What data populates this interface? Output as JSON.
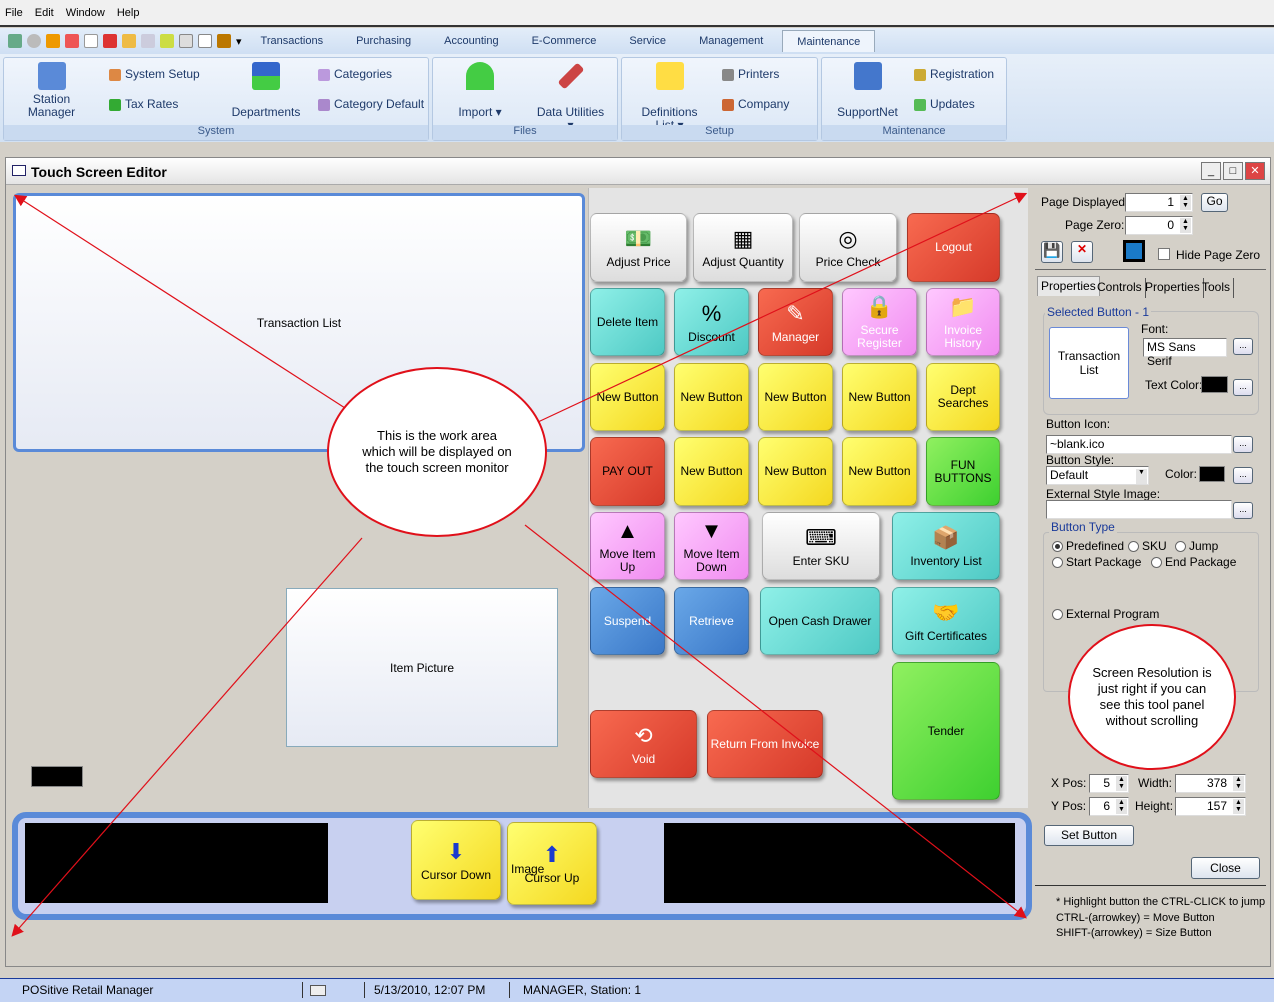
{
  "menu": [
    "File",
    "Edit",
    "Window",
    "Help"
  ],
  "ribbon_tabs": [
    "Transactions",
    "Purchasing",
    "Accounting",
    "E-Commerce",
    "Service",
    "Management",
    "Maintenance"
  ],
  "ribbon": {
    "station_manager": "Station Manager",
    "system_setup": "System Setup",
    "tax_rates": "Tax Rates",
    "departments": "Departments",
    "categories": "Categories",
    "category_default": "Category Default",
    "system": "System",
    "import": "Import",
    "data_utilities": "Data Utilities",
    "files": "Files",
    "definitions_list": "Definitions List",
    "printers": "Printers",
    "company": "Company",
    "setup": "Setup",
    "supportnet": "SupportNet",
    "registration": "Registration",
    "updates": "Updates",
    "maintenance": "Maintenance"
  },
  "window": {
    "title": "Touch Screen Editor",
    "minimize": "_",
    "maximize": "□",
    "close": "✕"
  },
  "editor": {
    "transaction_list": "Transaction List",
    "item_picture": "Item Picture",
    "buttons": {
      "adjust_price": "Adjust Price",
      "adjust_quantity": "Adjust Quantity",
      "price_check": "Price Check",
      "logout": "Logout",
      "delete_item": "Delete Item",
      "discount": "Discount",
      "manager": "Manager",
      "secure_register": "Secure Register",
      "invoice_history": "Invoice History",
      "new_button": "New Button",
      "dept_searches": "Dept Searches",
      "pay_out": "PAY OUT",
      "fun_buttons": "FUN BUTTONS",
      "move_item_up": "Move Item Up",
      "move_item_down": "Move Item Down",
      "enter_sku": "Enter SKU",
      "inventory_list": "Inventory List",
      "suspend": "Suspend",
      "retrieve": "Retrieve",
      "open_cash_drawer": "Open Cash Drawer",
      "gift_certificates": "Gift Certificates",
      "void": "Void",
      "return_from_invoice": "Return From Invoice",
      "tender": "Tender",
      "cursor_down": "Cursor Down",
      "cursor_up": "Cursor Up",
      "image": "Image"
    }
  },
  "annotations": {
    "work_area": "This is the work area which will be displayed on the touch screen monitor",
    "resolution": "Screen Resolution is just right if you can see this tool panel without scrolling",
    "color": "#e0101a"
  },
  "panel": {
    "page_displayed_label": "Page Displayed:",
    "page_displayed": "1",
    "go": "Go",
    "page_zero_label": "Page Zero:",
    "page_zero": "0",
    "hide_page_zero": "Hide Page Zero",
    "hide_page_zero_checked": false,
    "tabs": [
      "Properties",
      "Controls",
      "Properties",
      "Tools"
    ],
    "selected_button": "Selected Button - 1",
    "preview": "Transaction List",
    "font_label": "Font:",
    "font": "MS Sans Serif",
    "text_color_label": "Text Color:",
    "text_color": "#000000",
    "button_icon_label": "Button Icon:",
    "button_icon": "~blank.ico",
    "button_style_label": "Button Style:",
    "button_style": "Default",
    "color_label": "Color:",
    "color": "#000000",
    "external_style_label": "External Style Image:",
    "external_style": "",
    "button_type": "Button Type",
    "types": [
      "Predefined",
      "SKU",
      "Jump",
      "Start Package",
      "End Package",
      "External Program"
    ],
    "selected_type": "Predefined",
    "xpos_label": "X Pos:",
    "xpos": "5",
    "ypos_label": "Y Pos:",
    "ypos": "6",
    "width_label": "Width:",
    "width": "378",
    "height_label": "Height:",
    "height": "157",
    "set_button": "Set Button",
    "close": "Close",
    "ellipsis": "...",
    "help": [
      "* Highlight button the CTRL-CLICK to jump",
      "CTRL-(arrowkey) = Move Button",
      "SHIFT-(arrowkey) = Size Button"
    ]
  },
  "status": {
    "app": "POSitive Retail Manager",
    "datetime": "5/13/2010, 12:07 PM",
    "user": "MANAGER, Station: 1"
  }
}
